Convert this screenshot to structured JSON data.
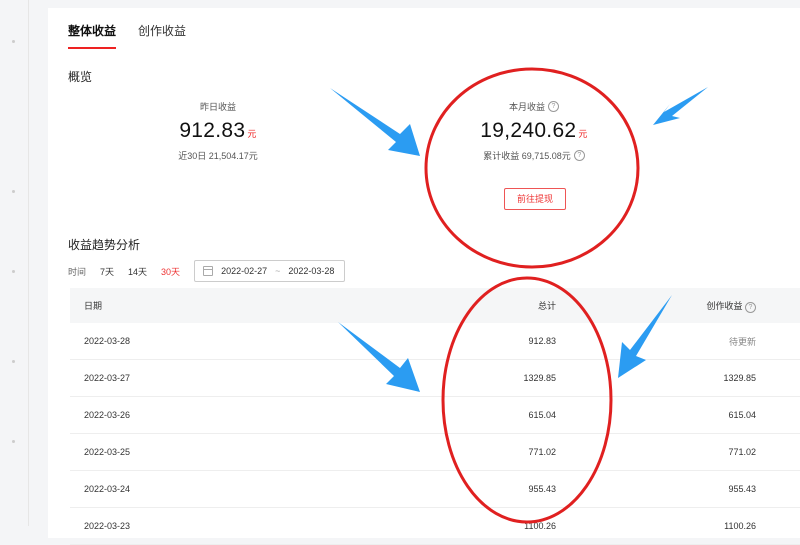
{
  "tabs": [
    {
      "label": "整体收益",
      "active": true
    },
    {
      "label": "创作收益",
      "active": false
    }
  ],
  "overview": {
    "title": "概览",
    "yesterday": {
      "label": "昨日收益",
      "value": "912.83",
      "unit": "元",
      "sub": "近30日 21,504.17元"
    },
    "month": {
      "label": "本月收益",
      "value": "19,240.62",
      "unit": "元",
      "sub": "累计收益 69,715.08元"
    },
    "withdraw_button": "前往提现"
  },
  "trend": {
    "title": "收益趋势分析",
    "time_label": "时间",
    "ranges": [
      {
        "label": "7天",
        "active": false
      },
      {
        "label": "14天",
        "active": false
      },
      {
        "label": "30天",
        "active": true
      }
    ],
    "start_date": "2022-02-27",
    "end_date": "2022-03-28",
    "separator": "~"
  },
  "table": {
    "headers": {
      "date": "日期",
      "total": "总计",
      "create": "创作收益"
    },
    "rows": [
      {
        "date": "2022-03-28",
        "total": "912.83",
        "create": "待更新"
      },
      {
        "date": "2022-03-27",
        "total": "1329.85",
        "create": "1329.85"
      },
      {
        "date": "2022-03-26",
        "total": "615.04",
        "create": "615.04"
      },
      {
        "date": "2022-03-25",
        "total": "771.02",
        "create": "771.02"
      },
      {
        "date": "2022-03-24",
        "total": "955.43",
        "create": "955.43"
      },
      {
        "date": "2022-03-23",
        "total": "1100.26",
        "create": "1100.26"
      }
    ]
  },
  "icons": {
    "help": "question-circle-icon",
    "calendar": "calendar-icon"
  },
  "colors": {
    "accent": "#e22222",
    "annotation_arrow": "#2b9cf2",
    "annotation_circle": "#e02020"
  }
}
